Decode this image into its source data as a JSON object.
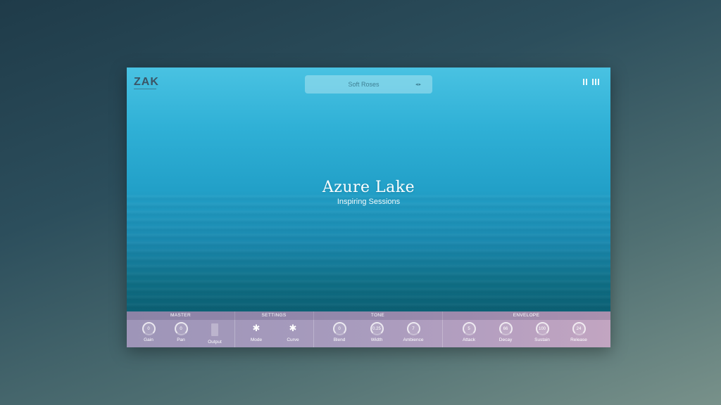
{
  "header": {
    "logo": "ZAK",
    "preset": "Soft Roses",
    "preset_prev": "◂",
    "preset_next": "▸"
  },
  "hero": {
    "title": "Azure Lake",
    "subtitle": "Inspiring Sessions"
  },
  "sections": {
    "master": {
      "label": "MASTER",
      "gain": {
        "label": "Gain",
        "value": "0"
      },
      "pan": {
        "label": "Pan",
        "value": "0"
      },
      "output": {
        "label": "Output"
      }
    },
    "settings": {
      "label": "SETTINGS",
      "mode": {
        "label": "Mode"
      },
      "curve": {
        "label": "Curve"
      }
    },
    "tone": {
      "label": "TONE",
      "blend": {
        "label": "Blend",
        "value": "0"
      },
      "width": {
        "label": "Width",
        "value": "0.25"
      },
      "ambience": {
        "label": "Ambience",
        "value": "7"
      }
    },
    "envelope": {
      "label": "ENVELOPE",
      "attack": {
        "label": "Attack",
        "value": "5"
      },
      "decay": {
        "label": "Decay",
        "value": "66"
      },
      "sustain": {
        "label": "Sustain",
        "value": "100"
      },
      "release": {
        "label": "Release",
        "value": "24"
      }
    }
  },
  "icons": {
    "menu": "menu-icon",
    "gear": "gear-icon"
  },
  "colors": {
    "water_top": "#49c2e2",
    "water_bottom": "#0b5f73",
    "panel_left": "#9e95b8",
    "panel_right": "#c2a5c1"
  }
}
